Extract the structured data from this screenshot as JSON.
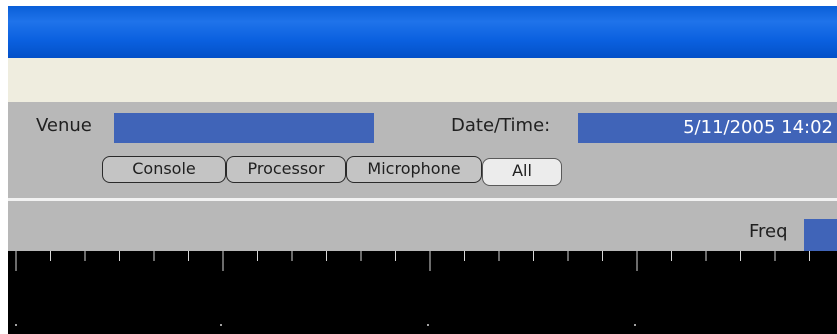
{
  "window": {
    "title": ""
  },
  "info": {
    "venue_label": "Venue",
    "venue_value": "",
    "datetime_label": "Date/Time:",
    "datetime_value": "5/11/2005 14:02"
  },
  "filter_tabs": [
    {
      "label": "Console"
    },
    {
      "label": "Processor"
    },
    {
      "label": "Microphone"
    },
    {
      "label": "All",
      "selected": true
    }
  ],
  "graph": {
    "freq_label": "Freq",
    "freq_value": ""
  },
  "colors": {
    "title_bar": "#0a5fd8",
    "field_bg": "#4064b8",
    "panel_bg": "#b8b8b8",
    "graph_bg": "#000000"
  }
}
